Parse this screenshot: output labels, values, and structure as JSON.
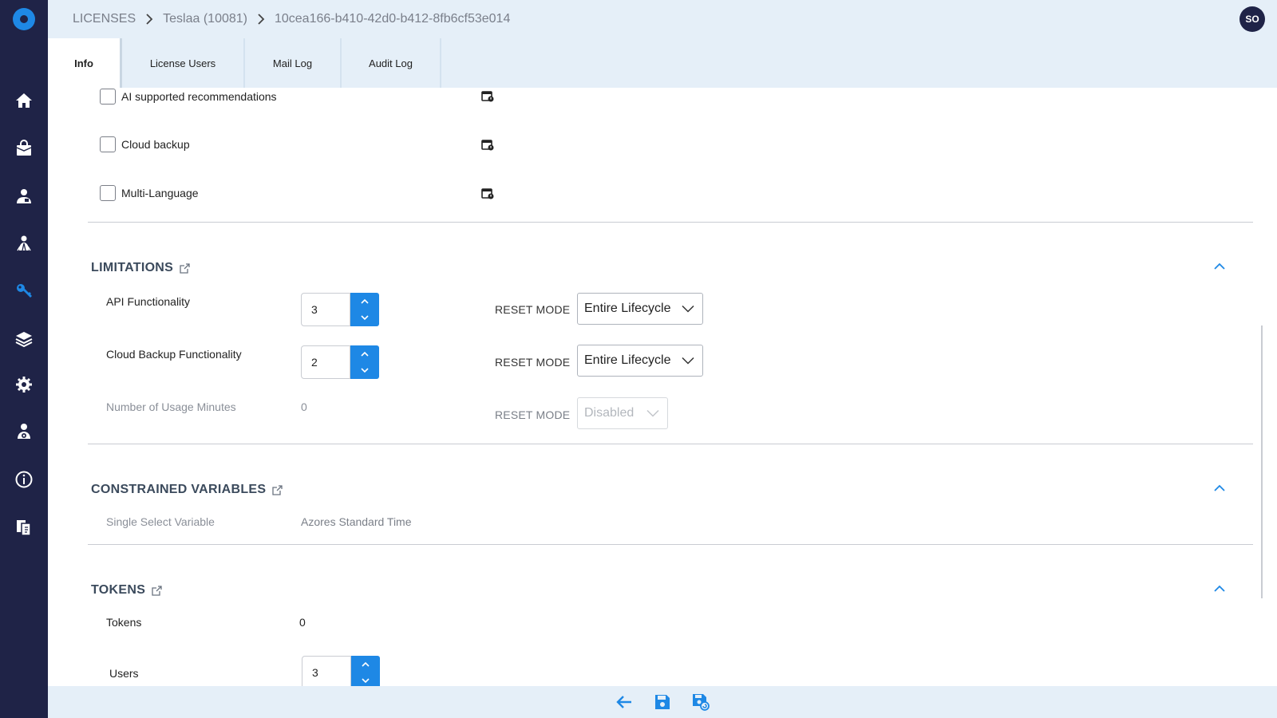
{
  "header": {
    "breadcrumb": [
      "LICENSES",
      "Teslaa (10081)",
      "10cea166-b410-42d0-b412-8fb6cf53e014"
    ],
    "avatar_initials": "SO"
  },
  "sidebar": {
    "items": [
      "home-icon",
      "shopping-bag-icon",
      "user-icon",
      "users-icon",
      "key-icon",
      "layers-icon",
      "gear-icon",
      "user-settings-icon",
      "info-icon",
      "help-icon"
    ],
    "active_index": 4
  },
  "tabs": [
    {
      "label": "Info",
      "active": true
    },
    {
      "label": "License Users",
      "active": false
    },
    {
      "label": "Mail Log",
      "active": false
    },
    {
      "label": "Audit Log",
      "active": false
    }
  ],
  "features": [
    {
      "label": "AI supported recommendations",
      "checked": false
    },
    {
      "label": "Cloud backup",
      "checked": false
    },
    {
      "label": "Multi-Language",
      "checked": false
    }
  ],
  "limitations": {
    "title": "LIMITATIONS",
    "rows": [
      {
        "label": "API Functionality",
        "value": "3",
        "reset_label": "RESET MODE",
        "reset_value": "Entire Lifecycle"
      },
      {
        "label": "Cloud Backup Functionality",
        "value": "2",
        "reset_label": "RESET MODE",
        "reset_value": "Entire Lifecycle"
      },
      {
        "label": "Number of Usage Minutes",
        "value": "0",
        "reset_label": "RESET MODE",
        "reset_value": "Disabled"
      }
    ]
  },
  "constrained": {
    "title": "CONSTRAINED VARIABLES",
    "label": "Single Select Variable",
    "value": "Azores Standard Time"
  },
  "tokens": {
    "title": "TOKENS",
    "tokens_label": "Tokens",
    "tokens_value": "0",
    "users_label": "Users",
    "users_value": "3"
  },
  "colors": {
    "sidebar": "#1f2347",
    "accent": "#1e88e5",
    "header_bg": "#e5eff8"
  }
}
